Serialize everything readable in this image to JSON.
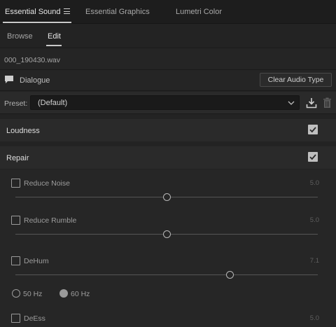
{
  "tabs": [
    {
      "label": "Essential Sound",
      "active": true
    },
    {
      "label": "Essential Graphics",
      "active": false
    },
    {
      "label": "Lumetri Color",
      "active": false
    }
  ],
  "subtabs": [
    {
      "label": "Browse",
      "active": false
    },
    {
      "label": "Edit",
      "active": true
    }
  ],
  "file_name": "000_190430.wav",
  "audio_type": {
    "label": "Dialogue",
    "clear_button": "Clear Audio Type"
  },
  "preset": {
    "label": "Preset:",
    "value": "(Default)"
  },
  "sections": {
    "loudness": {
      "title": "Loudness",
      "checked": true
    },
    "repair": {
      "title": "Repair",
      "checked": true
    }
  },
  "repair": {
    "reduce_noise": {
      "label": "Reduce Noise",
      "value": "5.0",
      "checked": false,
      "level": 0.5
    },
    "reduce_rumble": {
      "label": "Reduce Rumble",
      "value": "5.0",
      "checked": false,
      "level": 0.5
    },
    "dehum": {
      "label": "DeHum",
      "value": "7.1",
      "checked": false,
      "level": 0.71
    },
    "dehum_freq": {
      "options": [
        "50 Hz",
        "60 Hz"
      ],
      "selected": "60 Hz"
    },
    "deess": {
      "label": "DeEss",
      "value": "5.0",
      "checked": false
    }
  },
  "colors": {
    "background": "#232323",
    "header": "#1d1d1d",
    "accent_check": "#bfbfbf"
  },
  "icons": [
    "menu-icon",
    "speech-bubble-icon",
    "chevron-down-icon",
    "save-preset-icon",
    "trash-icon",
    "checkmark-icon"
  ]
}
